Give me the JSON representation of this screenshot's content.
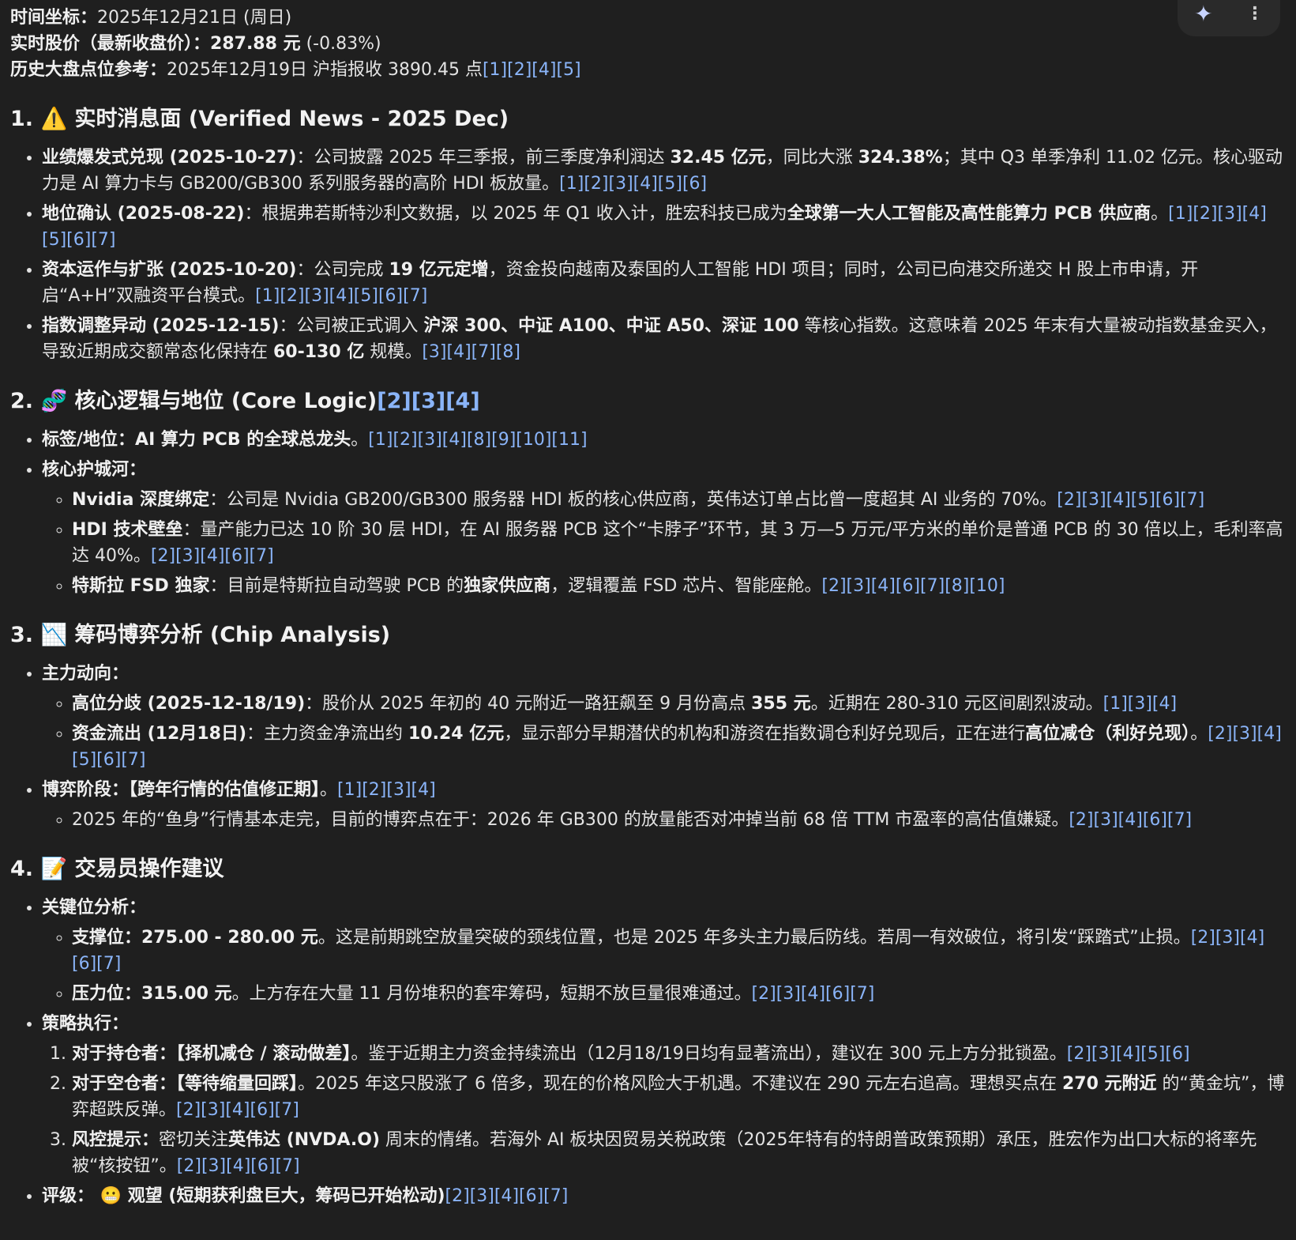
{
  "toolbar": {
    "spark_icon": "✦",
    "more_icon": "⋮"
  },
  "meta": {
    "time_label": "时间坐标：",
    "time_value": "2025年12月21日 (周日)",
    "price_label": "实时股价（最新收盘价）：",
    "price_value": "287.88 元",
    "price_change": " (-0.83%)",
    "index_label": "历史大盘点位参考：",
    "index_value": "2025年12月19日 沪指报收 3890.45 点",
    "index_refs": "[1][2][4][5]"
  },
  "s1": {
    "title": "1. ⚠️ 实时消息面 (Verified News - 2025 Dec)",
    "items": [
      {
        "pre": "",
        "b1": "业绩爆发式兑现 (2025-10-27)",
        "t1": "：公司披露 2025 年三季报，前三季度净利润达 ",
        "b2": "32.45 亿元",
        "t2": "，同比大涨 ",
        "b3": "324.38%",
        "t3": "；其中 Q3 单季净利 11.02 亿元。核心驱动力是 AI 算力卡与 GB200/GB300 系列服务器的高阶 HDI 板放量。",
        "refs": "[1][2][3][4][5][6]"
      },
      {
        "pre": "",
        "b1": "地位确认 (2025-08-22)",
        "t1": "：根据弗若斯特沙利文数据，以 2025 年 Q1 收入计，胜宏科技已成为",
        "b2": "全球第一大人工智能及高性能算力 PCB 供应商",
        "t2": "。",
        "b3": "",
        "t3": "",
        "refs": "[1][2][3][4][5][6][7]"
      },
      {
        "pre": "",
        "b1": "资本运作与扩张 (2025-10-20)",
        "t1": "：公司完成 ",
        "b2": "19 亿元定增",
        "t2": "，资金投向越南及泰国的人工智能 HDI 项目；同时，公司已向港交所递交 H 股上市申请，开启“A+H”双融资平台模式。",
        "b3": "",
        "t3": "",
        "refs": "[1][2][3][4][5][6][7]"
      },
      {
        "pre": "",
        "b1": "指数调整异动 (2025-12-15)",
        "t1": "：公司被正式调入 ",
        "b2": "沪深 300、中证 A100、中证 A50、深证 100",
        "t2": " 等核心指数。这意味着 2025 年末有大量被动指数基金买入，导致近期成交额常态化保持在 ",
        "b3": "60-130 亿",
        "t3": " 规模。",
        "refs": "[3][4][7][8]"
      }
    ]
  },
  "s2": {
    "title_text": "2. 🧬 核心逻辑与地位 (Core Logic)",
    "title_refs": "[2][3][4]",
    "tag_label": "标签/地位",
    "tag_value": "：AI 算力 PCB 的全球总龙头",
    "tag_tail": "。",
    "tag_refs": "[1][2][3][4][8][9][10][11]",
    "moat_label": "核心护城河",
    "moat_colon": "：",
    "moat_items": [
      {
        "b1": "Nvidia 深度绑定",
        "t1": "：公司是 Nvidia GB200/GB300 服务器 HDI 板的核心供应商，英伟达订单占比曾一度超其 AI 业务的 70%。",
        "b2": "",
        "t2": "",
        "refs": "[2][3][4][5][6][7]"
      },
      {
        "b1": "HDI 技术壁垒",
        "t1": "：量产能力已达 10 阶 30 层 HDI，在 AI 服务器 PCB 这个“卡脖子”环节，其 3 万—5 万元/平方米的单价是普通 PCB 的 30 倍以上，毛利率高达 40%。",
        "b2": "",
        "t2": "",
        "refs": "[2][3][4][6][7]"
      },
      {
        "b1": "特斯拉 FSD 独家",
        "t1": "：目前是特斯拉自动驾驶 PCB 的",
        "b2": "独家供应商",
        "t2": "，逻辑覆盖 FSD 芯片、智能座舱。",
        "refs": "[2][3][4][6][7][8][10]"
      }
    ]
  },
  "s3": {
    "title": "3. 📉 筹码博弈分析 (Chip Analysis)",
    "main_label": "主力动向",
    "main_colon": "：",
    "main_items": [
      {
        "b1": "高位分歧 (2025-12-18/19)",
        "t1": "：股价从 2025 年初的 40 元附近一路狂飙至 9 月份高点 ",
        "b2": "355 元",
        "t2": "。近期在 280-310 元区间剧烈波动。",
        "refs": "[1][3][4]"
      },
      {
        "b1": "资金流出 (12月18日)",
        "t1": "：主力资金净流出约 ",
        "b2": "10.24 亿元",
        "t2": "，显示部分早期潜伏的机构和游资在指数调仓利好兑现后，正在进行",
        "b3": "高位减仓（利好兑现）",
        "t3": "。",
        "refs": "[2][3][4][5][6][7]"
      }
    ],
    "stage_label": "博弈阶段",
    "stage_value": "：【跨年行情的估值修正期】",
    "stage_tail": "。",
    "stage_refs": "[1][2][3][4]",
    "stage_items": [
      {
        "t1": "2025 年的“鱼身”行情基本走完，目前的博弈点在于：2026 年 GB300 的放量能否对冲掉当前 68 倍 TTM 市盈率的高估值嫌疑。",
        "refs": "[2][3][4][6][7]"
      }
    ]
  },
  "s4": {
    "title": "4. 📝 交易员操作建议",
    "key_label": "关键位分析",
    "key_colon": "：",
    "key_items": [
      {
        "b1": "支撑位：275.00 - 280.00 元",
        "t1": "。这是前期跳空放量突破的颈线位置，也是 2025 年多头主力最后防线。若周一有效破位，将引发“踩踏式”止损。",
        "refs": "[2][3][4][6][7]"
      },
      {
        "b1": "压力位：315.00 元",
        "t1": "。上方存在大量 11 月份堆积的套牢筹码，短期不放巨量很难通过。",
        "refs": "[2][3][4][6][7]"
      }
    ],
    "strategy_label": "策略执行",
    "strategy_colon": "：",
    "strategy_items": [
      {
        "b1": "对于持仓者：【择机减仓 / 滚动做差】",
        "t1": "。鉴于近期主力资金持续流出（12月18/19日均有显著流出），建议在 300 元上方分批锁盈。",
        "b2": "",
        "t2": "",
        "refs": "[2][3][4][5][6]"
      },
      {
        "b1": "对于空仓者：【等待缩量回踩】",
        "t1": "。2025 年这只股涨了 6 倍多，现在的价格风险大于机遇。不建议在 290 元左右追高。理想买点在 ",
        "b2": "270 元附近",
        "t2": " 的“黄金坑”，博弈超跌反弹。",
        "refs": "[2][3][4][6][7]"
      },
      {
        "b1": "风控提示：",
        "t1": "密切关注",
        "b2": "英伟达 (NVDA.O)",
        "t2": " 周末的情绪。若海外 AI 板块因贸易关税政策（2025年特有的特朗普政策预期）承压，胜宏作为出口大标的将率先被“核按钮”。",
        "refs": "[2][3][4][6][7]"
      }
    ],
    "rating_label": "评级",
    "rating_colon": "： ",
    "rating_emoji": "😬",
    "rating_value": " 观望 (短期获利盘巨大，筹码已开始松动)",
    "rating_refs": "[2][3][4][6][7]"
  }
}
